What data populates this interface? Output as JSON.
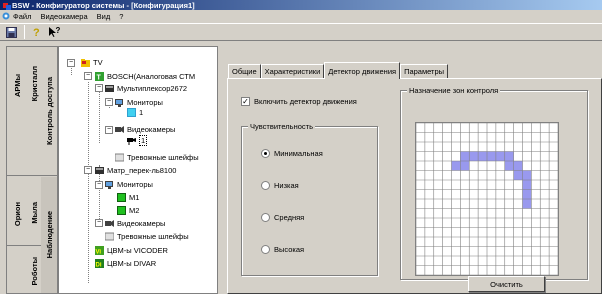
{
  "window": {
    "title": "BSW - Конфигуратор системы - [Конфигурация1]"
  },
  "menu": [
    {
      "label": "Файл"
    },
    {
      "label": "Видеокамера"
    },
    {
      "label": "Вид"
    },
    {
      "label": "?"
    }
  ],
  "toolbar": [
    {
      "icon": "save-icon"
    },
    {
      "icon": "help-icon"
    },
    {
      "icon": "whats-this-icon"
    }
  ],
  "vnav": [
    {
      "label": "АРМы",
      "color": "#000000"
    },
    {
      "label": "Кристалл",
      "color": "#000000"
    },
    {
      "label": "Контроль доступа",
      "color": "#000000"
    },
    {
      "label": "Орион",
      "color": "#000000"
    },
    {
      "label": "Мыла",
      "color": "#000000"
    },
    {
      "label": "Роботы",
      "color": "#000000"
    },
    {
      "label": "Наблюдение",
      "color": "#000000"
    }
  ],
  "tree": {
    "root": "TV",
    "matrix1": "BOSCH(Аналоговая СТМ",
    "mux": "Мультиплексор2672",
    "monitors1": "Мониторы",
    "monitor1": "1",
    "cameras1": "Видеокамеры",
    "camera1": "1",
    "alarms1": "Тревожные шлейфы",
    "matrix2": "Матр_перек-ль8100",
    "monitors2": "Мониторы",
    "m1": "M1",
    "m2": "M2",
    "cameras2": "Видеокамеры",
    "alarms2": "Тревожные шлейфы",
    "vicoder": "ЦВМ-ы VICODER",
    "divar": "ЦВМ-ы DIVAR"
  },
  "tabs": [
    {
      "label": "Общие",
      "active": false
    },
    {
      "label": "Характеристики",
      "active": false
    },
    {
      "label": "Детектор движения",
      "active": true
    },
    {
      "label": "Параметры",
      "active": false
    }
  ],
  "motion": {
    "enable_label": "Включить детектор движения",
    "enabled": true,
    "sensitivity_title": "Чувствительность",
    "options": [
      {
        "label": "Минимальная",
        "selected": true
      },
      {
        "label": "Низкая",
        "selected": false
      },
      {
        "label": "Средняя",
        "selected": false
      },
      {
        "label": "Высокая",
        "selected": false
      }
    ],
    "zone_title": "Назначение зон контроля",
    "zone_grid": {
      "cols": 16,
      "rows": 16,
      "selected_color": "#9999ee",
      "selected_cells": [
        [
          3,
          5
        ],
        [
          3,
          6
        ],
        [
          3,
          7
        ],
        [
          3,
          8
        ],
        [
          3,
          9
        ],
        [
          3,
          10
        ],
        [
          4,
          4
        ],
        [
          4,
          5
        ],
        [
          4,
          10
        ],
        [
          4,
          11
        ],
        [
          5,
          11
        ],
        [
          5,
          12
        ],
        [
          6,
          12
        ],
        [
          7,
          12
        ],
        [
          8,
          12
        ]
      ]
    },
    "clear_button": "Очистить"
  }
}
